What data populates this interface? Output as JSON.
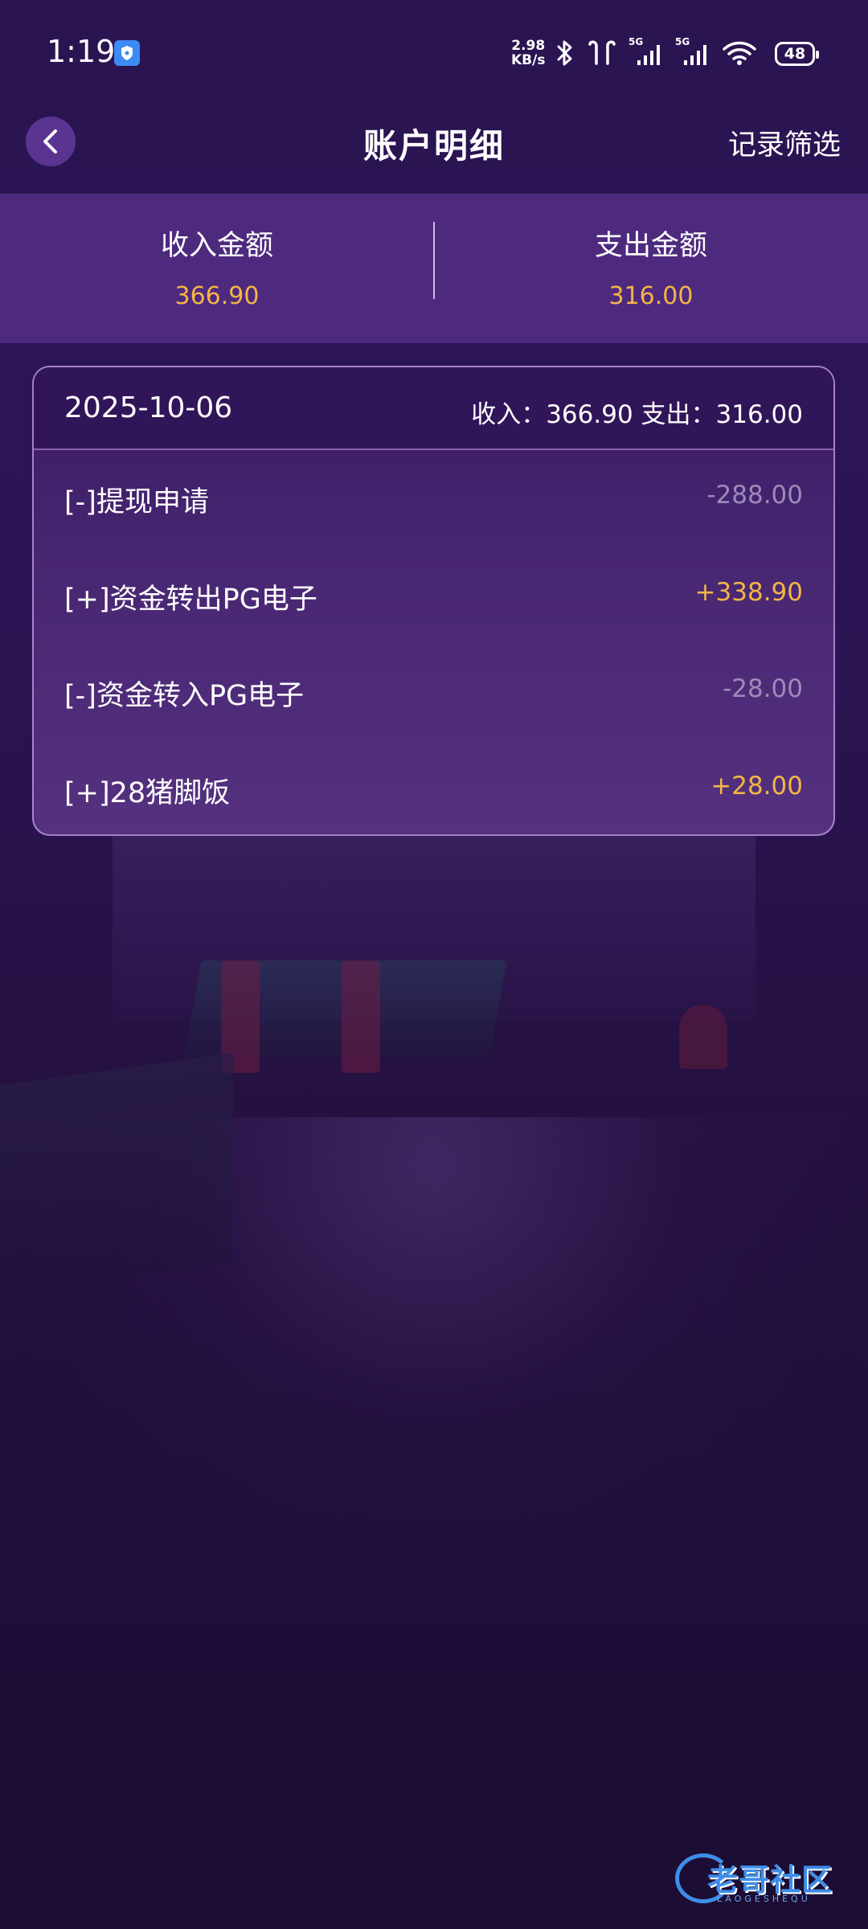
{
  "status_bar": {
    "time": "1:19",
    "net_speed_value": "2.98",
    "net_speed_unit": "KB/s",
    "signal1_label": "5G",
    "signal2_label": "5G",
    "battery": "48"
  },
  "header": {
    "title": "账户明细",
    "filter_label": "记录筛选"
  },
  "summary": {
    "income_label": "收入金额",
    "income_value": "366.90",
    "expense_label": "支出金额",
    "expense_value": "316.00"
  },
  "card": {
    "date": "2025-10-06",
    "totals": "收入：366.90 支出：316.00",
    "rows": [
      {
        "name": "[-]提现申请",
        "amount": "-288.00",
        "type": "negative"
      },
      {
        "name": "[+]资金转出PG电子",
        "amount": "+338.90",
        "type": "positive"
      },
      {
        "name": "[-]资金转入PG电子",
        "amount": "-28.00",
        "type": "negative"
      },
      {
        "name": "[+]28猪脚饭",
        "amount": "+28.00",
        "type": "positive"
      }
    ]
  },
  "watermark": {
    "text": "老哥社区",
    "subtext": "LAOGESHEQU"
  },
  "colors": {
    "accent_amount": "#f3b547",
    "negative_amount": "#9b8bb8",
    "summary_band": "#4e2a7e",
    "back_button": "#5a3491"
  }
}
